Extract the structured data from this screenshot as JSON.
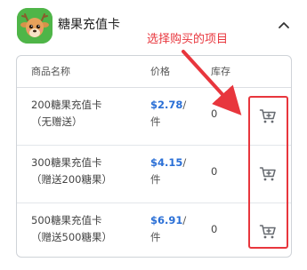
{
  "header": {
    "title": "糖果充值卡",
    "app_icon": "deer-icon",
    "collapse_icon": "chevron-up-icon"
  },
  "annotation": {
    "text": "选择购买的项目",
    "color": "#e8363d"
  },
  "table": {
    "columns": {
      "name": "商品名称",
      "price": "价格",
      "stock": "库存"
    },
    "rows": [
      {
        "name_line1": "200糖果充值卡",
        "name_line2": "（无赠送）",
        "price": "$2.78",
        "price_unit_1": "/",
        "price_unit_2": "件",
        "stock": "0",
        "action_icon": "add-to-cart-icon"
      },
      {
        "name_line1": "300糖果充值卡",
        "name_line2": "（赠送200糖果）",
        "price": "$4.15",
        "price_unit_1": "/",
        "price_unit_2": "件",
        "stock": "0",
        "action_icon": "add-to-cart-icon"
      },
      {
        "name_line1": "500糖果充值卡",
        "name_line2": "（赠送500糖果）",
        "price": "$6.91",
        "price_unit_1": "/",
        "price_unit_2": "件",
        "stock": "0",
        "action_icon": "add-to-cart-icon"
      }
    ]
  },
  "colors": {
    "price": "#2a6fd6",
    "highlight": "#e8363d",
    "icon_green": "#4fb548"
  }
}
